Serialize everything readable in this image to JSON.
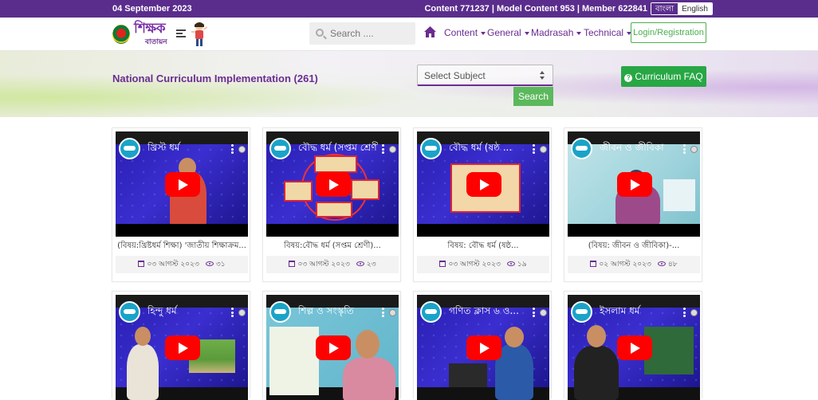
{
  "topbar": {
    "date": "04 September 2023",
    "content_label": "Content",
    "content_count": "771237",
    "model_content_label": "Model Content",
    "model_content_count": "953",
    "member_label": "Member",
    "member_count": "622841",
    "lang_bn": "বাংলা",
    "lang_en": "English"
  },
  "navbar": {
    "logo_text": "শিক্ষক",
    "logo_sub": "বাতায়ন",
    "search_placeholder": "Search ....",
    "menu": [
      "Content",
      "General",
      "Madrasah",
      "Technical"
    ],
    "login_label": "Login/Registration"
  },
  "hero": {
    "title": "National Curriculum Implementation (261)",
    "select_placeholder": "Select Subject",
    "search_button": "Search",
    "faq_button": "Curriculum FAQ"
  },
  "videos": [
    {
      "overlay": "খ্রিস্ট ধর্ম",
      "title": "(বিষয়:খ্রিষ্টধর্ম শিক্ষা) 'জাতীয় শিক্ষাক্রম...",
      "date": "০৩ আগস্ট ২০২৩",
      "views": "৩১"
    },
    {
      "overlay": "বৌদ্ধ ধর্ম (সপ্তম শ্রেণী)",
      "title": "বিষয়:বৌদ্ধ ধর্ম (সপ্তম শ্রেণী)...",
      "date": "০৩ আগস্ট ২০২৩",
      "views": "২৩"
    },
    {
      "overlay": "বৌদ্ধ ধর্ম (ষষ্ঠ ...",
      "title": "বিষয়: বৌদ্ধ ধর্ম (ষষ্ঠ...",
      "date": "০৩ আগস্ট ২০২৩",
      "views": "১৯"
    },
    {
      "overlay": "জীবন ও জীবিকা",
      "title": "(বিষয়: জীবন ও জীবিকা)-...",
      "date": "০২ আগস্ট ২০২৩",
      "views": "৪৮"
    },
    {
      "overlay": "হিন্দু ধর্ম",
      "title": "",
      "date": "",
      "views": ""
    },
    {
      "overlay": "শিল্প ও সংস্কৃতি",
      "title": "",
      "date": "",
      "views": ""
    },
    {
      "overlay": "গণিত ক্লাস ৬ ও...",
      "title": "",
      "date": "",
      "views": ""
    },
    {
      "overlay": "ইসলাম ধর্ম",
      "title": "",
      "date": "",
      "views": ""
    }
  ]
}
